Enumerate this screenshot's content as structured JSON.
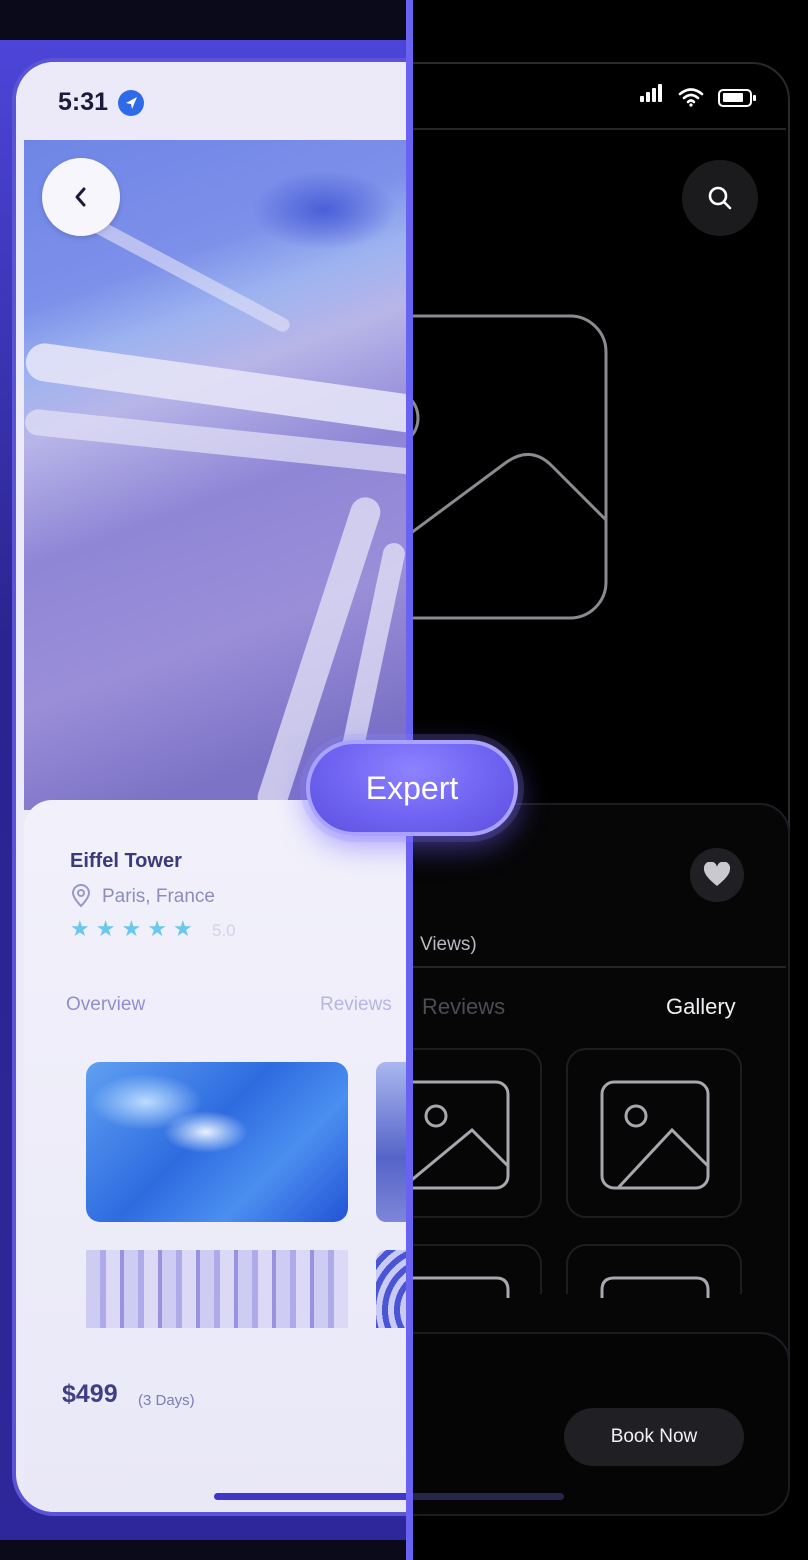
{
  "label": {
    "badge": "Expert"
  },
  "left_screen": {
    "status": {
      "time": "5:31"
    },
    "place": {
      "title": "Eiffel Tower",
      "location": "Paris, France",
      "rating": "5.0",
      "stars": 5
    },
    "tabs": [
      "Overview",
      "Reviews"
    ],
    "price": "$499",
    "duration": "(3 Days)"
  },
  "right_screen": {
    "views_fragment": "Views)",
    "tabs": [
      "Reviews",
      "Gallery"
    ],
    "active_tab": "Gallery",
    "book_button": "Book Now"
  },
  "colors": {
    "accent": "#6a62f0",
    "star": "#6cc7ee",
    "dark_surface": "#202024"
  },
  "icons": [
    "back-chevron-icon",
    "location-arrow-icon",
    "pin-icon",
    "star-icon",
    "signal-icon",
    "wifi-icon",
    "battery-icon",
    "search-icon",
    "heart-icon",
    "image-placeholder-icon"
  ]
}
